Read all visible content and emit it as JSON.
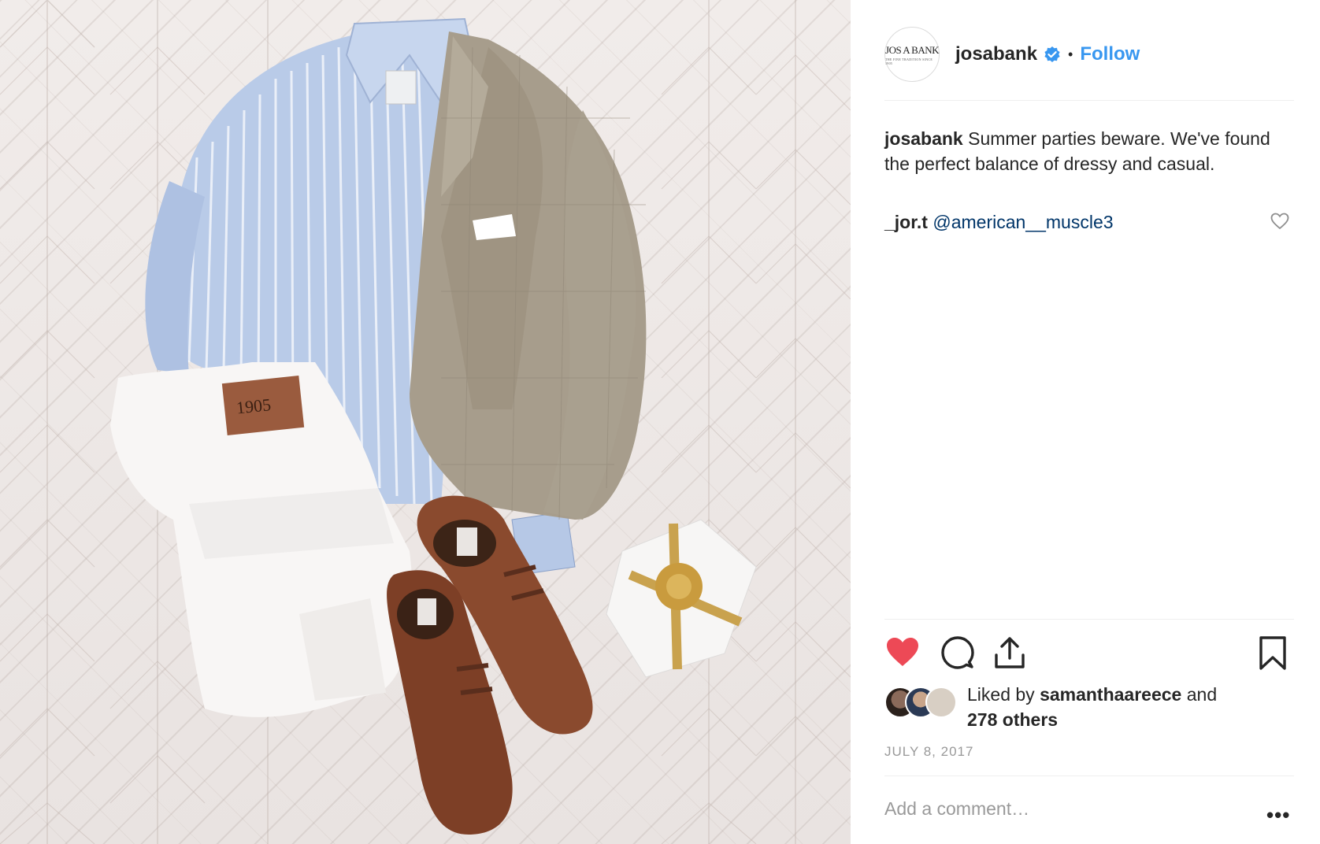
{
  "post": {
    "photo_alt": "flat lay outfit",
    "header": {
      "avatar_logo_main": "JOS A BANK",
      "avatar_logo_sub": "THE FINE TRADITION SINCE 1905",
      "username": "josabank",
      "verified_icon": "verified-badge-icon",
      "separator": "•",
      "follow_label": "Follow"
    },
    "caption": {
      "username": "josabank",
      "text": " Summer parties beware. We've found the perfect balance of dressy and casual."
    },
    "comment": {
      "username": "_jor.t",
      "mention": "@american__muscle3",
      "like_icon": "heart-outline-icon"
    },
    "actions": {
      "like_icon": "heart-filled-icon",
      "comment_icon": "comment-icon",
      "share_icon": "share-icon",
      "save_icon": "bookmark-icon"
    },
    "likes": {
      "prefix": "Liked by ",
      "user": "samanthaareece",
      "middle": " and",
      "others": "278 others"
    },
    "date": "JULY 8, 2017",
    "add_comment_placeholder": "Add a comment…",
    "more_label": "•••"
  },
  "colors": {
    "follow_blue": "#3897f0",
    "like_red": "#ed4956",
    "mention_blue": "#003569",
    "meta_gray": "#999999"
  }
}
